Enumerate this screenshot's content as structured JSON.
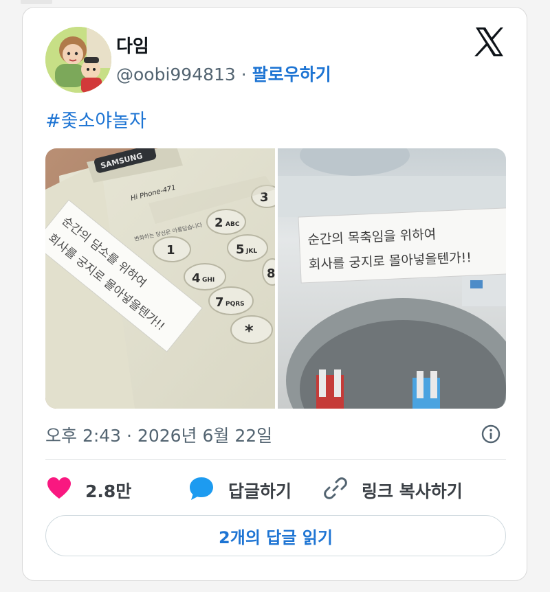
{
  "tweet": {
    "display_name": "다임",
    "handle": "@oobi994813",
    "separator": " · ",
    "follow_label": "팔로우하기",
    "hashtag": "#좇소야놀자",
    "timestamp": "오후 2:43 · 2026년 6월 22일"
  },
  "media": {
    "left_photo": {
      "phone_brand": "SAMSUNG",
      "phone_model": "Hi Phone-471",
      "phone_slogan": "변화하는 당신은 아름답습니다",
      "keys": [
        {
          "num": "1",
          "letters": ""
        },
        {
          "num": "2",
          "letters": "ABC"
        },
        {
          "num": "3",
          "letters": ""
        },
        {
          "num": "4",
          "letters": "GHI"
        },
        {
          "num": "5",
          "letters": "JKL"
        },
        {
          "num": "7",
          "letters": "PQRS"
        },
        {
          "num": "*",
          "letters": ""
        },
        {
          "num": "8",
          "letters": ""
        }
      ],
      "note_line1": "순간의 담소를 위하여",
      "note_line2": "회사를 궁지로 몰아넣을텐가!!"
    },
    "right_photo": {
      "note_line1": "순간의 목축임을 위하여",
      "note_line2": "회사를 궁지로 몰아넣을텐가!!"
    }
  },
  "actions": {
    "like_count": "2.8만",
    "reply_label": "답글하기",
    "copy_link_label": "링크 복사하기"
  },
  "read_replies_label": "2개의 답글 읽기",
  "colors": {
    "link_blue": "#1d74d3",
    "like_pink": "#f91880",
    "reply_blue": "#1d9bf0",
    "text_gray": "#536471"
  },
  "icons": [
    "x-logo-icon",
    "info-icon",
    "heart-icon",
    "reply-bubble-icon",
    "link-icon"
  ]
}
